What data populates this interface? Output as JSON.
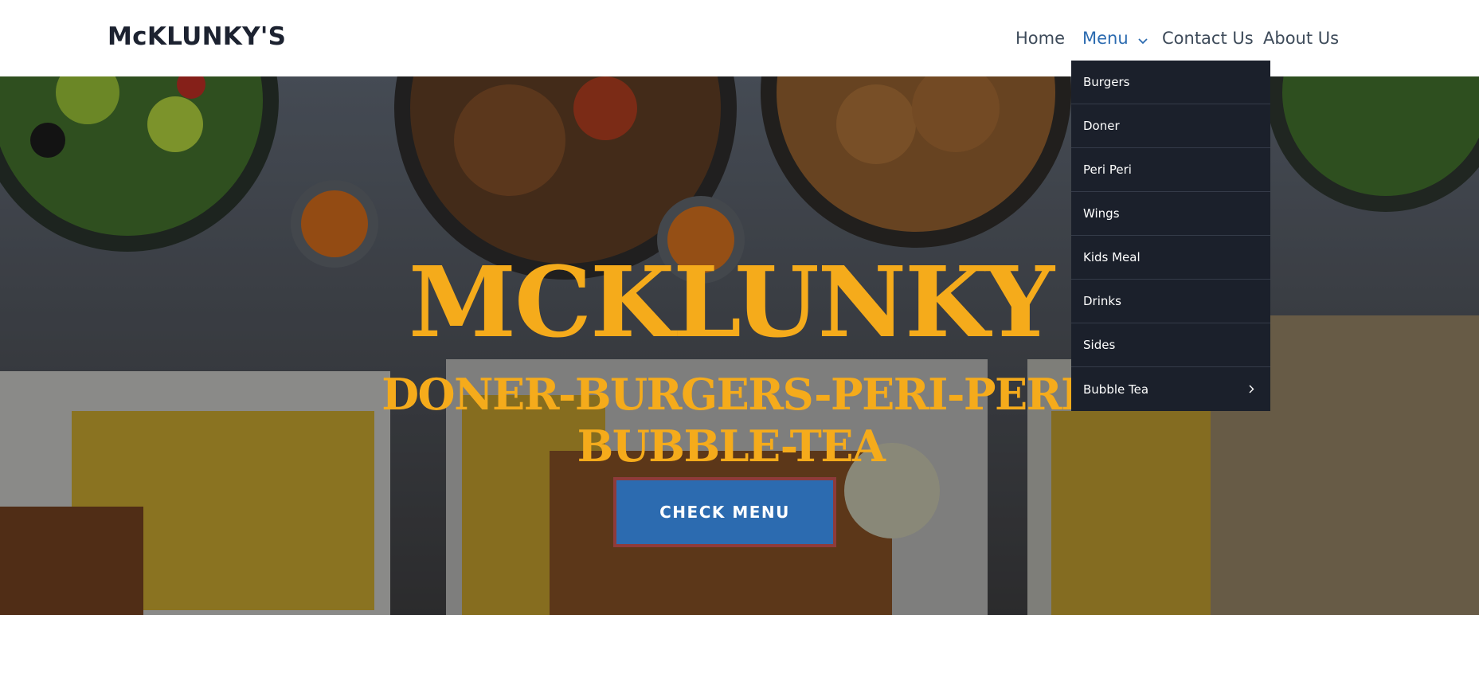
{
  "brand": {
    "logo_text": "McKLUNKY'S"
  },
  "nav": {
    "items": [
      {
        "label": "Home"
      },
      {
        "label": "Menu",
        "active": true
      },
      {
        "label": "Contact Us"
      },
      {
        "label": "About Us"
      }
    ]
  },
  "menu_dropdown": {
    "items": [
      {
        "label": "Burgers"
      },
      {
        "label": "Doner"
      },
      {
        "label": "Peri Peri"
      },
      {
        "label": "Wings"
      },
      {
        "label": "Kids Meal"
      },
      {
        "label": "Drinks"
      },
      {
        "label": "Sides"
      },
      {
        "label": "Bubble Tea",
        "has_submenu": true
      }
    ]
  },
  "hero": {
    "title": "MCKLUNKY",
    "subtitle_line1": "DONER-BURGERS-PERI-PERI",
    "subtitle_line2": "BUBBLE-TEA",
    "cta_label": "CHECK MENU"
  },
  "colors": {
    "accent_yellow": "#f5ab1b",
    "cta_blue": "#2c6bb0",
    "cta_border": "#8e3b3b",
    "nav_active": "#2c6bb0",
    "dropdown_bg": "#1b202b"
  },
  "icons": {
    "menu_chevron": "chevron-down-icon",
    "submenu_arrow": "chevron-right-icon"
  }
}
